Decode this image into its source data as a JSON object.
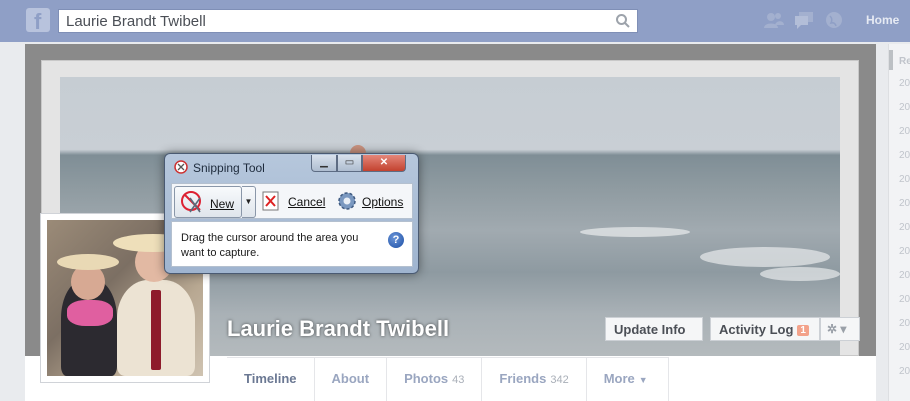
{
  "topbar": {
    "logo": "f",
    "search_value": "Laurie Brandt Twibell",
    "home_label": "Home",
    "icons": [
      "friend-requests-icon",
      "messages-icon",
      "notifications-globe-icon"
    ]
  },
  "rail": {
    "heading": "Re",
    "items": [
      "20",
      "20",
      "20",
      "20",
      "20",
      "20",
      "20",
      "20",
      "20",
      "20",
      "20",
      "20",
      "20"
    ]
  },
  "profile": {
    "name": "Laurie Brandt Twibell",
    "update_info": "Update Info",
    "activity_log": "Activity Log",
    "activity_badge": "1",
    "gear": "✲ ▾"
  },
  "tabs": [
    {
      "label": "Timeline",
      "count": ""
    },
    {
      "label": "About",
      "count": ""
    },
    {
      "label": "Photos",
      "count": "43"
    },
    {
      "label": "Friends",
      "count": "342"
    },
    {
      "label": "More",
      "count": ""
    }
  ],
  "snipping_tool": {
    "title": "Snipping Tool",
    "new_label": "New",
    "cancel_label": "Cancel",
    "options_label": "Options",
    "message": "Drag the cursor around the area you want to capture.",
    "help": "?",
    "minimize": "▁",
    "maximize": "▭",
    "close": "✕"
  },
  "colors": {
    "topbar": "#8f9fc6",
    "link": "#9aa6c0",
    "badge": "#f3a28a"
  }
}
